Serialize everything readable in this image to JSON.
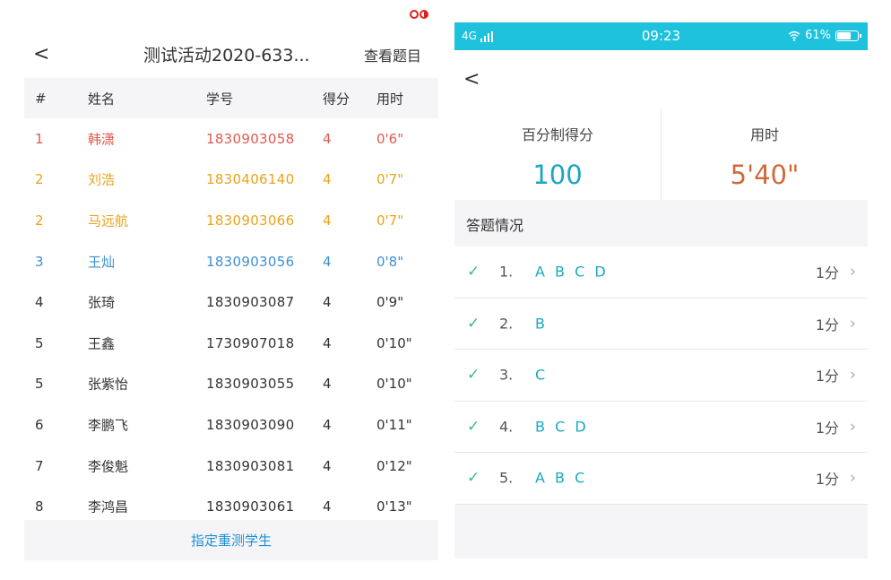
{
  "left": {
    "header": {
      "back_glyph": "<",
      "title": "测试活动2020-633...",
      "view_questions": "查看题目"
    },
    "table": {
      "columns": [
        "#",
        "姓名",
        "学号",
        "得分",
        "用时"
      ],
      "rows": [
        {
          "rank": "1",
          "name": "韩潇",
          "id": "1830903058",
          "score": "4",
          "time": "0'6\"",
          "color": "#e05a4f"
        },
        {
          "rank": "2",
          "name": "刘浩",
          "id": "1830406140",
          "score": "4",
          "time": "0'7\"",
          "color": "#eaa319"
        },
        {
          "rank": "2",
          "name": "马远航",
          "id": "1830903066",
          "score": "4",
          "time": "0'7\"",
          "color": "#eaa319"
        },
        {
          "rank": "3",
          "name": "王灿",
          "id": "1830903056",
          "score": "4",
          "time": "0'8\"",
          "color": "#3f8fd1"
        },
        {
          "rank": "4",
          "name": "张琦",
          "id": "1830903087",
          "score": "4",
          "time": "0'9\"",
          "color": "#333333"
        },
        {
          "rank": "5",
          "name": "王鑫",
          "id": "1730907018",
          "score": "4",
          "time": "0'10\"",
          "color": "#333333"
        },
        {
          "rank": "5",
          "name": "张紫怡",
          "id": "1830903055",
          "score": "4",
          "time": "0'10\"",
          "color": "#333333"
        },
        {
          "rank": "6",
          "name": "李鹏飞",
          "id": "1830903090",
          "score": "4",
          "time": "0'11\"",
          "color": "#333333"
        },
        {
          "rank": "7",
          "name": "李俊魁",
          "id": "1830903081",
          "score": "4",
          "time": "0'12\"",
          "color": "#333333"
        },
        {
          "rank": "8",
          "name": "李鸿昌",
          "id": "1830903061",
          "score": "4",
          "time": "0'13\"",
          "color": "#333333"
        }
      ]
    },
    "footer_button": "指定重测学生"
  },
  "right": {
    "status_bar": {
      "network": "4G",
      "time": "09:23",
      "battery": "61%"
    },
    "back_glyph": "<",
    "stats": {
      "score_label": "百分制得分",
      "score_value": "100",
      "time_label": "用时",
      "time_value": "5'40\""
    },
    "section_label": "答题情况",
    "answers": [
      {
        "num": "1.",
        "answer": "A B C D",
        "score": "1分"
      },
      {
        "num": "2.",
        "answer": "B",
        "score": "1分"
      },
      {
        "num": "3.",
        "answer": "C",
        "score": "1分"
      },
      {
        "num": "4.",
        "answer": "B C D",
        "score": "1分"
      },
      {
        "num": "5.",
        "answer": "A B C",
        "score": "1分"
      }
    ]
  }
}
